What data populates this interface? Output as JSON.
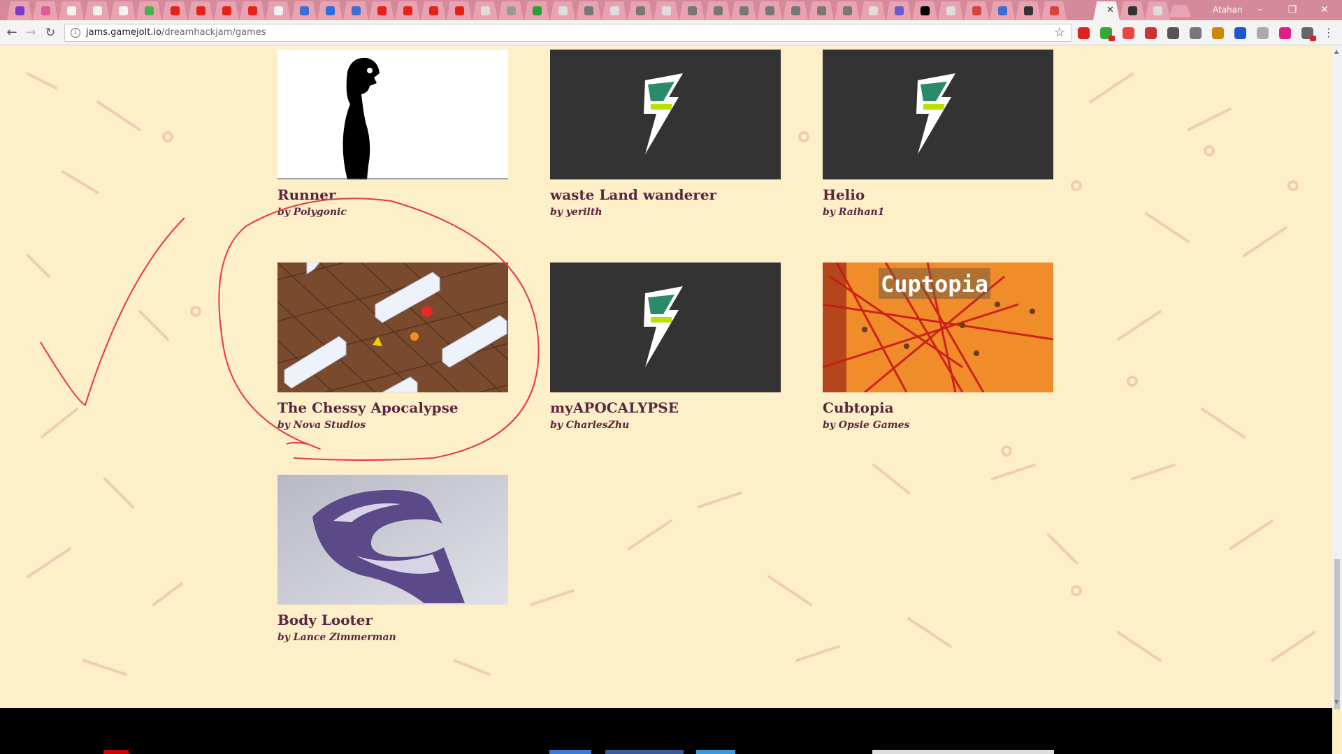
{
  "browser": {
    "profile_name": "Atahan",
    "url_host": "jams.gamejolt.io",
    "url_path": "/dreamhackjam/games",
    "controls": {
      "minimize": "–",
      "restore": "❐",
      "close": "✕"
    }
  },
  "games": [
    {
      "title": "Runner",
      "author": "by Polygonic",
      "thumbnail": "silhouette"
    },
    {
      "title": "waste Land wanderer",
      "author": "by yerilth",
      "thumbnail": "gamejolt-default"
    },
    {
      "title": "Helio",
      "author": "by Raihan1",
      "thumbnail": "gamejolt-default"
    },
    {
      "title": "The Chessy Apocalypse",
      "author": "by Nova Studios",
      "thumbnail": "isometric-board"
    },
    {
      "title": "myAPOCALYPSE",
      "author": "by CharlesZhu",
      "thumbnail": "gamejolt-default"
    },
    {
      "title": "Cubtopia",
      "author": "by Opsie Games",
      "thumbnail": "cuptopia",
      "thumbnail_text": "Cuptopia"
    },
    {
      "title": "Body Looter",
      "author": "by Lance Zimmerman",
      "thumbnail": "purple-logo"
    }
  ],
  "colors": {
    "page_bg": "#fdefc8",
    "title": "#5a2740",
    "annotation": "#e53a3a",
    "tab_strip": "#d48a9b"
  }
}
